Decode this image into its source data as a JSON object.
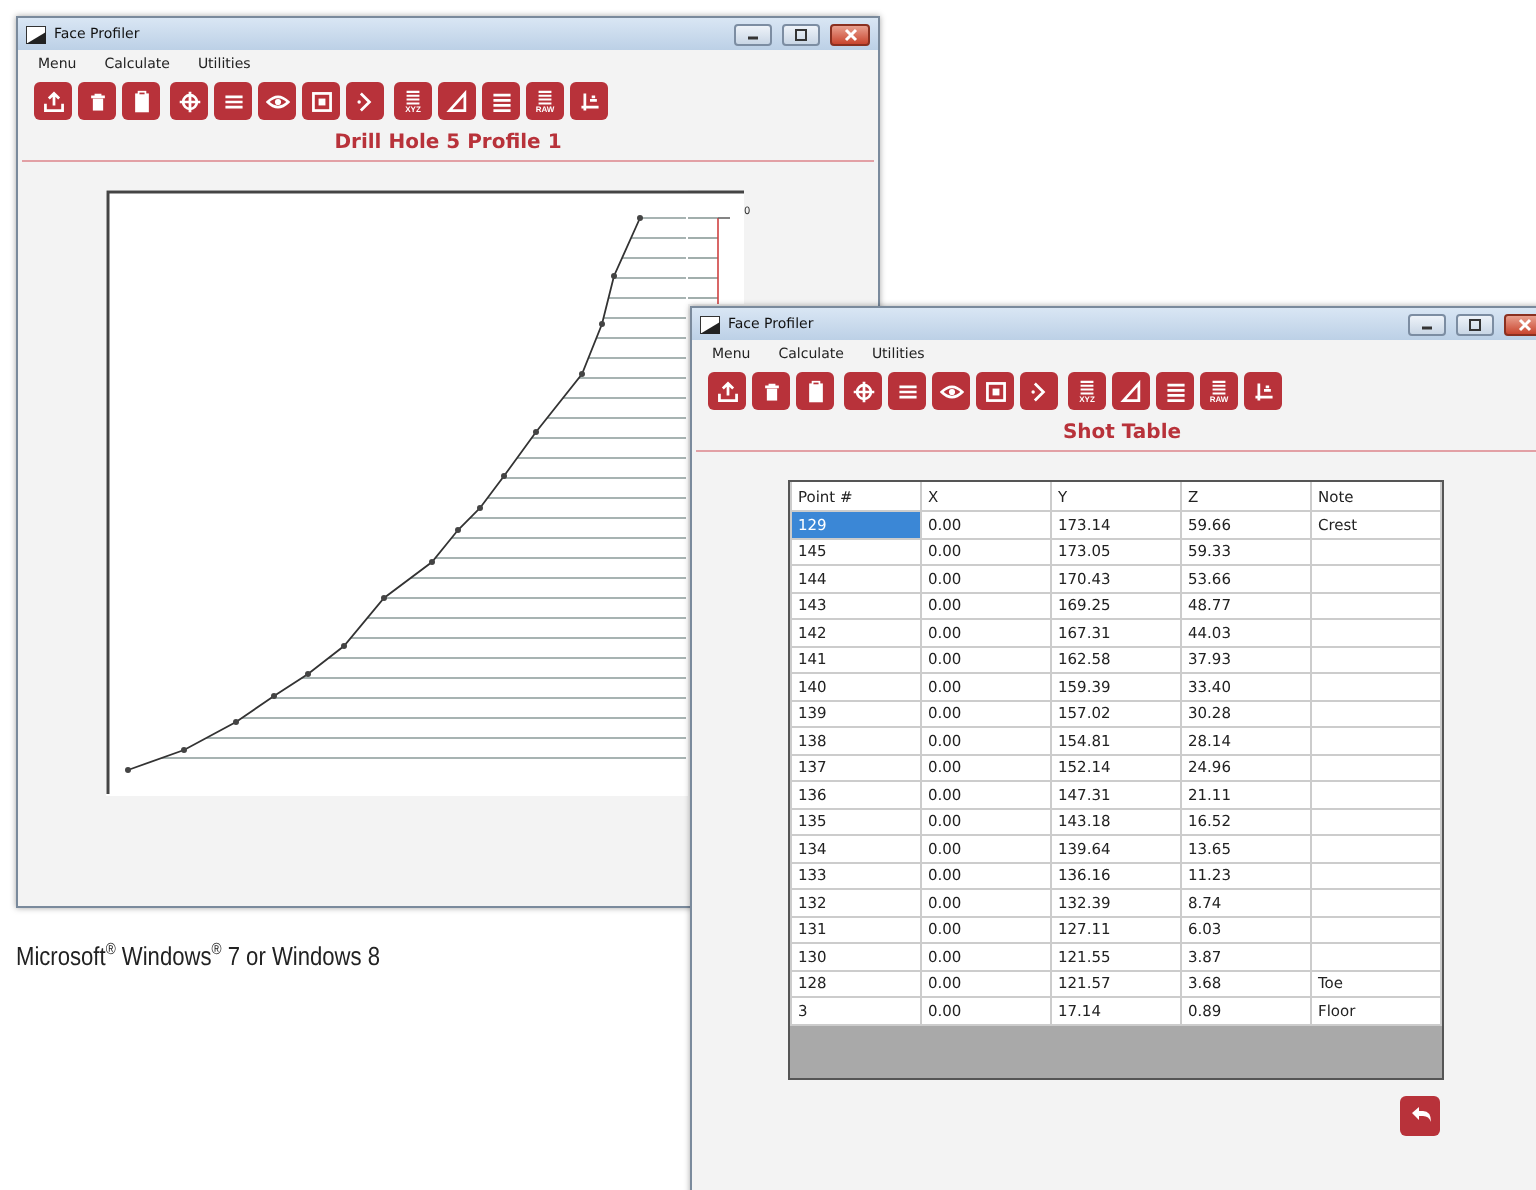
{
  "windows": [
    {
      "title": "Face Profiler",
      "menu": [
        "Menu",
        "Calculate",
        "Utilities"
      ],
      "toolbar": [
        [
          {
            "kind": "upload"
          },
          {
            "kind": "trash"
          },
          {
            "kind": "clipboard"
          }
        ],
        [
          {
            "kind": "target"
          },
          {
            "kind": "lines"
          },
          {
            "kind": "eye"
          },
          {
            "kind": "frame"
          },
          {
            "kind": "chevron"
          }
        ],
        [
          {
            "kind": "list",
            "label": "XYZ"
          },
          {
            "kind": "triangle"
          },
          {
            "kind": "list"
          },
          {
            "kind": "list",
            "label": "RAW"
          },
          {
            "kind": "axes"
          }
        ]
      ],
      "heading": "Drill Hole 5 Profile 1",
      "plot": {
        "axis_label": "0"
      }
    },
    {
      "title": "Face Profiler",
      "menu": [
        "Menu",
        "Calculate",
        "Utilities"
      ],
      "toolbar": [
        [
          {
            "kind": "upload"
          },
          {
            "kind": "trash"
          },
          {
            "kind": "clipboard"
          }
        ],
        [
          {
            "kind": "target"
          },
          {
            "kind": "lines"
          },
          {
            "kind": "eye"
          },
          {
            "kind": "frame"
          },
          {
            "kind": "chevron"
          }
        ],
        [
          {
            "kind": "list",
            "label": "XYZ"
          },
          {
            "kind": "triangle"
          },
          {
            "kind": "list"
          },
          {
            "kind": "list",
            "label": "RAW"
          },
          {
            "kind": "axes"
          }
        ]
      ],
      "heading": "Shot Table",
      "table": {
        "columns": [
          "Point #",
          "X",
          "Y",
          "Z",
          "Note"
        ],
        "rows": [
          {
            "cells": [
              "129",
              "0.00",
              "173.14",
              "59.66",
              "Crest"
            ],
            "selected": true
          },
          {
            "cells": [
              "145",
              "0.00",
              "173.05",
              "59.33",
              ""
            ],
            "selected": false
          },
          {
            "cells": [
              "144",
              "0.00",
              "170.43",
              "53.66",
              ""
            ],
            "selected": false
          },
          {
            "cells": [
              "143",
              "0.00",
              "169.25",
              "48.77",
              ""
            ],
            "selected": false
          },
          {
            "cells": [
              "142",
              "0.00",
              "167.31",
              "44.03",
              ""
            ],
            "selected": false
          },
          {
            "cells": [
              "141",
              "0.00",
              "162.58",
              "37.93",
              ""
            ],
            "selected": false
          },
          {
            "cells": [
              "140",
              "0.00",
              "159.39",
              "33.40",
              ""
            ],
            "selected": false
          },
          {
            "cells": [
              "139",
              "0.00",
              "157.02",
              "30.28",
              ""
            ],
            "selected": false
          },
          {
            "cells": [
              "138",
              "0.00",
              "154.81",
              "28.14",
              ""
            ],
            "selected": false
          },
          {
            "cells": [
              "137",
              "0.00",
              "152.14",
              "24.96",
              ""
            ],
            "selected": false
          },
          {
            "cells": [
              "136",
              "0.00",
              "147.31",
              "21.11",
              ""
            ],
            "selected": false
          },
          {
            "cells": [
              "135",
              "0.00",
              "143.18",
              "16.52",
              ""
            ],
            "selected": false
          },
          {
            "cells": [
              "134",
              "0.00",
              "139.64",
              "13.65",
              ""
            ],
            "selected": false
          },
          {
            "cells": [
              "133",
              "0.00",
              "136.16",
              "11.23",
              ""
            ],
            "selected": false
          },
          {
            "cells": [
              "132",
              "0.00",
              "132.39",
              "8.74",
              ""
            ],
            "selected": false
          },
          {
            "cells": [
              "131",
              "0.00",
              "127.11",
              "6.03",
              ""
            ],
            "selected": false
          },
          {
            "cells": [
              "130",
              "0.00",
              "121.55",
              "3.87",
              ""
            ],
            "selected": false
          },
          {
            "cells": [
              "128",
              "0.00",
              "121.57",
              "3.68",
              "Toe"
            ],
            "selected": false
          },
          {
            "cells": [
              "3",
              "0.00",
              "17.14",
              "0.89",
              "Floor"
            ],
            "selected": false
          }
        ]
      }
    }
  ],
  "caption": "Microsoft$^{®}$ Windows$^{®}$ 7 or Windows 8"
}
